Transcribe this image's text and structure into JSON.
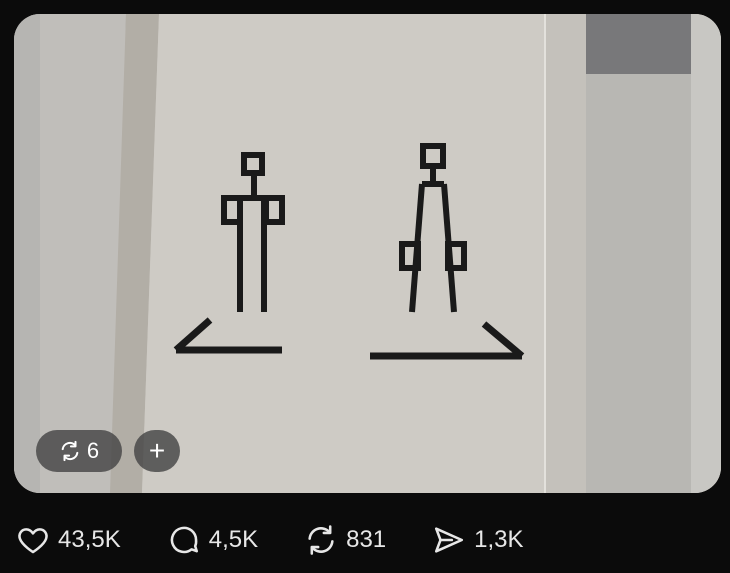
{
  "media": {
    "repost_count": "6",
    "add_label": "+"
  },
  "actions": {
    "likes": "43,5K",
    "replies": "4,5K",
    "reposts": "831",
    "shares": "1,3K"
  },
  "icons": {
    "like": "heart-icon",
    "reply": "speech-bubble-icon",
    "repost": "repost-icon",
    "share": "send-icon",
    "add": "plus-icon"
  },
  "colors": {
    "background": "#0b0b0b",
    "text": "#e7e7e7",
    "pill": "#464646"
  }
}
